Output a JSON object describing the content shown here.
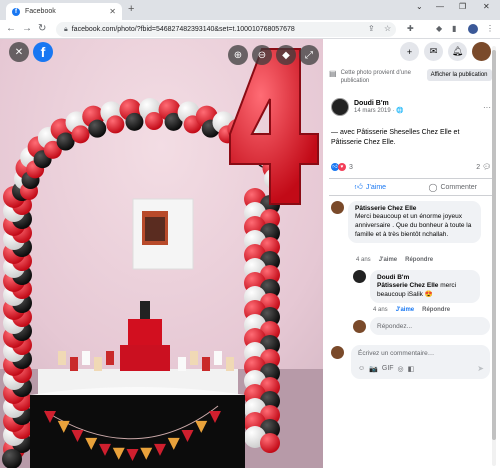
{
  "browser": {
    "tab_title": "Facebook",
    "new_tab": "+",
    "address": "facebook.com/photo/?fbid=546827482393140&set=t.100010768057678",
    "controls": {
      "minimize": "—",
      "maximize": "❐",
      "close": "✕",
      "chevron": "⌄"
    }
  },
  "viewer": {
    "close": "✕",
    "logo": "f",
    "zoom_in": "⊕",
    "zoom_out": "⊖",
    "tag": "◆",
    "fullscreen": "⤢"
  },
  "photo_banner_letters": [
    "H",
    "A",
    "P",
    "P",
    "Y",
    "B",
    "I",
    "R",
    "T",
    "H",
    "D",
    "A",
    "Y"
  ],
  "colors": {
    "fb_blue": "#1877f2",
    "balloon_red": "#d90f1d",
    "balloon_black": "#151515",
    "balloon_white": "#f4f4f4"
  },
  "panel": {
    "notice_text": "Cette photo provient d’une publication",
    "notice_button": "Afficher la publication",
    "author_name": "Doudi B'm",
    "date": "14 mars 2019 · 🌐",
    "more": "···",
    "post_text": "— avec Pâtisserie Sheselles Chez Elle et Pâtisserie Chez Elle.",
    "reaction_count": "3",
    "comment_count": "2",
    "like_label": "J’aime",
    "comment_label": "Commenter",
    "comments": [
      {
        "name": "Pâtisserie Chez Elle",
        "text": "Merci beaucoup et un énorme joyeux anniversaire . Que du bonheur à toute la famille et à très bientôt nchallah.",
        "age": "4 ans",
        "like": "J'aime",
        "reply": "Répondre"
      },
      {
        "name": "Doudi B'm",
        "mention": "Pâtisserie Chez Elle",
        "text": " merci beaucoup iSalik 😍",
        "age": "4 ans",
        "like": "J'aime",
        "reply": "Répondre"
      }
    ],
    "reply_placeholder": "Répondez...",
    "write_placeholder": "Écrivez un commentaire…",
    "write_icons": [
      "☺",
      "📷",
      "GIF",
      "◎",
      "◧"
    ],
    "send": "➤"
  }
}
